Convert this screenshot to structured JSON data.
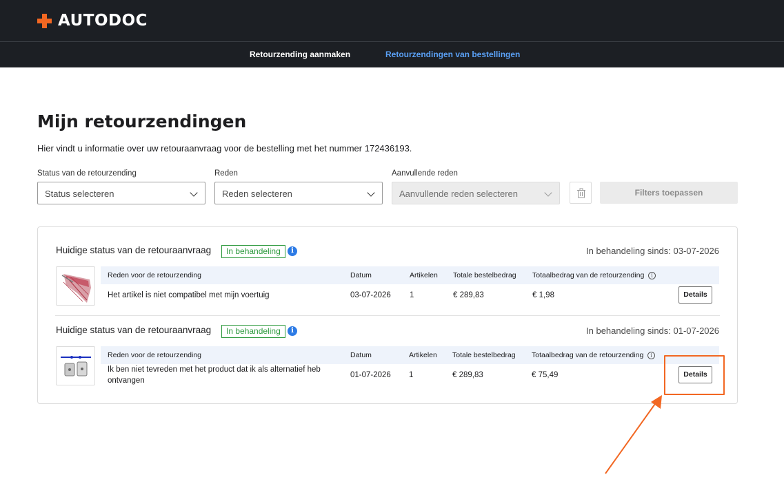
{
  "brand": {
    "name": "AUTODOC",
    "accent_color": "#f26722",
    "header_bg": "#1c1f24"
  },
  "nav": {
    "items": [
      {
        "label": "Retourzending aanmaken",
        "active": false
      },
      {
        "label": "Retourzendingen van bestellingen",
        "active": true
      }
    ],
    "active_color": "#5aa0f5"
  },
  "page": {
    "title": "Mijn retourzendingen",
    "intro": "Hier vindt u informatie over uw retouraanvraag voor de bestelling met het nummer 172436193."
  },
  "filters": {
    "status": {
      "label": "Status van de retourzending",
      "placeholder": "Status selecteren"
    },
    "reason": {
      "label": "Reden",
      "placeholder": "Reden selecteren"
    },
    "extra_reason": {
      "label": "Aanvullende reden",
      "placeholder": "Aanvullende reden selecteren",
      "disabled": true
    },
    "clear_icon": "trash-icon",
    "apply_label": "Filters toepassen"
  },
  "table_headers": {
    "reason": "Reden voor de retourzending",
    "date": "Datum",
    "items": "Artikelen",
    "order_total": "Totale bestelbedrag",
    "return_total": "Totaalbedrag van de retourzending"
  },
  "returns": [
    {
      "status_title": "Huidige status van de retouraanvraag",
      "status_badge": "In behandeling",
      "since": "In behandeling sinds: 03-07-2026",
      "reason": "Het artikel is niet compatibel met mijn voertuig",
      "date": "03-07-2026",
      "items": "1",
      "order_total": "€ 289,83",
      "return_total": "€ 1,98",
      "details_label": "Details"
    },
    {
      "status_title": "Huidige status van de retouraanvraag",
      "status_badge": "In behandeling",
      "since": "In behandeling sinds: 01-07-2026",
      "reason": "Ik ben niet tevreden met het product dat ik als alternatief heb ontvangen",
      "date": "01-07-2026",
      "items": "1",
      "order_total": "€ 289,83",
      "return_total": "€ 75,49",
      "details_label": "Details"
    }
  ],
  "colors": {
    "status_green": "#2e9a3e",
    "info_blue": "#2d7be5",
    "table_header_bg": "#eef3fb",
    "highlight": "#f26722"
  }
}
